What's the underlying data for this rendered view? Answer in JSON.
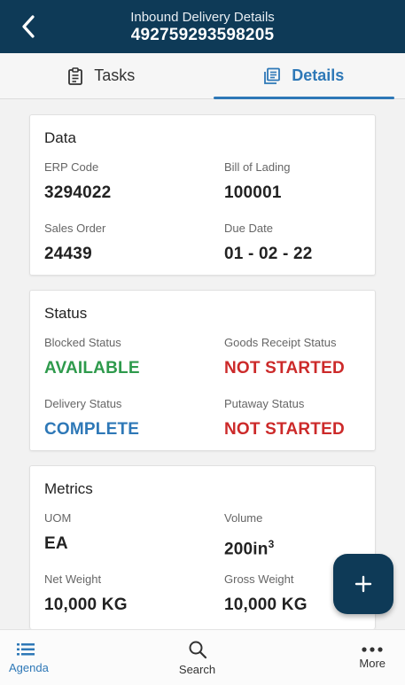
{
  "header": {
    "title": "Inbound Delivery Details",
    "subtitle": "492759293598205"
  },
  "tabs": [
    {
      "label": "Tasks",
      "icon": "clipboard-icon",
      "active": false
    },
    {
      "label": "Details",
      "icon": "document-list-icon",
      "active": true
    }
  ],
  "cards": {
    "data": {
      "title": "Data",
      "fields": [
        {
          "label": "ERP Code",
          "value": "3294022"
        },
        {
          "label": "Bill of Lading",
          "value": "100001"
        },
        {
          "label": "Sales Order",
          "value": "24439"
        },
        {
          "label": "Due Date",
          "value": "01 - 02 - 22"
        }
      ]
    },
    "status": {
      "title": "Status",
      "fields": [
        {
          "label": "Blocked Status",
          "value": "AVAILABLE",
          "color": "#2e9a4c"
        },
        {
          "label": "Goods Receipt Status",
          "value": "NOT STARTED",
          "color": "#cc2a2a"
        },
        {
          "label": "Delivery Status",
          "value": "COMPLETE",
          "color": "#2e78b7"
        },
        {
          "label": "Putaway Status",
          "value": "NOT STARTED",
          "color": "#cc2a2a"
        }
      ]
    },
    "metrics": {
      "title": "Metrics",
      "fields": [
        {
          "label": "UOM",
          "value": "EA"
        },
        {
          "label": "Volume",
          "value": "200in",
          "superscript": "3"
        },
        {
          "label": "Net Weight",
          "value": "10,000 KG"
        },
        {
          "label": "Gross Weight",
          "value": "10,000 KG"
        }
      ]
    }
  },
  "fab": {
    "icon": "plus-icon"
  },
  "bottom_nav": [
    {
      "label": "Agenda",
      "icon": "list-icon",
      "active": true
    },
    {
      "label": "Search",
      "icon": "search-icon",
      "active": false
    },
    {
      "label": "More",
      "icon": "more-dots-icon",
      "active": false
    }
  ],
  "colors": {
    "primary": "#0e3a57",
    "accent": "#2e78b7",
    "success": "#2e9a4c",
    "danger": "#cc2a2a"
  }
}
